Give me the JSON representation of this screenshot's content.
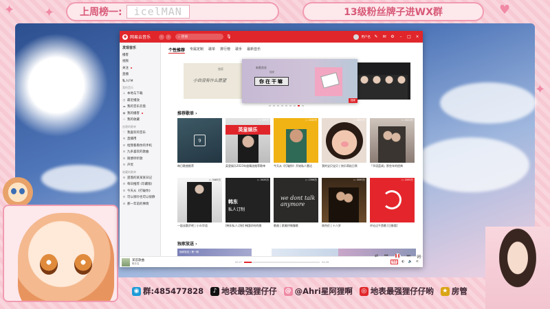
{
  "overlay": {
    "rank_label": "上周榜一:",
    "rank_name": "icelMAN",
    "group_text": "13级粉丝牌子进WX群",
    "socials": [
      {
        "icon": "penguin-icon",
        "text": "群:485477828",
        "color": "#1e9bd7"
      },
      {
        "icon": "douyin-icon",
        "text": "地表最强狸仔仔",
        "color": "#111111"
      },
      {
        "icon": "at-icon",
        "text": "@Ahri星阿狸啊",
        "color": "#f08aa5"
      },
      {
        "icon": "weibo-icon",
        "text": "地表最强狸仔仔哟",
        "color": "#e0262b"
      },
      {
        "icon": "badge-icon",
        "text": "房管",
        "color": "#d9a514"
      }
    ]
  },
  "app": {
    "name": "网易云音乐",
    "search_placeholder": "搜索",
    "username": "用户名",
    "sidebar": {
      "top_items": [
        {
          "label": "发现音乐",
          "active": true,
          "icon": ""
        },
        {
          "label": "播客",
          "icon": ""
        },
        {
          "label": "视频",
          "icon": ""
        },
        {
          "label": "关注",
          "icon": "",
          "dot": true
        },
        {
          "label": "直播",
          "icon": ""
        },
        {
          "label": "私人FM",
          "icon": ""
        }
      ],
      "my_music_head": "我的音乐",
      "my_music": [
        {
          "label": "本地与下载",
          "icon": "↓"
        },
        {
          "label": "最近播放",
          "icon": "◷"
        },
        {
          "label": "我的音乐云盘",
          "icon": "☁"
        },
        {
          "label": "我的播客",
          "icon": "◉",
          "dot": true
        },
        {
          "label": "我的收藏",
          "icon": "☆"
        }
      ],
      "created_head": "创建的歌单",
      "created": [
        {
          "label": "我喜欢的音乐",
          "icon": "♡"
        },
        {
          "label": "直播用",
          "icon": "≡"
        },
        {
          "label": "给我看看你的手机",
          "icon": "≡"
        },
        {
          "label": "九条喜欢的歌曲",
          "icon": "≡"
        },
        {
          "label": "随便听听歌",
          "icon": "≡"
        },
        {
          "label": "声优",
          "icon": "≡"
        }
      ],
      "collected_head": "收藏的歌单",
      "collected": [
        {
          "label": "遗落的某某某日记",
          "icon": "≡"
        },
        {
          "label": "每日推荐 (珍藏版)",
          "icon": "≡"
        },
        {
          "label": "今天从《打破你》",
          "icon": "≡"
        },
        {
          "label": "可以很吵也可以很静",
          "icon": "≡"
        },
        {
          "label": "那一年前的事情",
          "icon": "≡"
        }
      ]
    },
    "tabs": [
      "个性推荐",
      "专属定制",
      "歌单",
      "排行榜",
      "歌手",
      "最新音乐"
    ],
    "banner": {
      "left_text": "小白没有什么愿望",
      "left_sub": "独家",
      "center_sub": "新歌首发",
      "center_sub2": "独家",
      "center_title": "你在干嘛",
      "center_tag": "独家"
    },
    "section_playlists": "推荐歌单 ›",
    "section_exclusive": "独家放送 ›",
    "playlists": [
      {
        "title": "每日歌曲推荐",
        "plays": "",
        "cover": "c1",
        "cal": "9"
      },
      {
        "title": "英皇娱乐2023年度精选推荐歌单",
        "plays": "▷ 183万",
        "cover": "c2",
        "band": "英皇娱乐"
      },
      {
        "title": "今天从《打破你》开始私人雷达",
        "plays": "▷ 1042万",
        "cover": "c3"
      },
      {
        "title": "我的宝贝宝贝 | 快乐萌娃日常",
        "plays": "▷ 8855万",
        "cover": "c4"
      },
      {
        "title": "「华语蓝调」那些年的经典",
        "plays": "▷ 2021万",
        "cover": "c5"
      },
      {
        "title": "一起去散步吧 | 小众华语",
        "plays": "▷ 3465万",
        "cover": "c6"
      },
      {
        "title": "[韩东私人订制] 韩国好听的歌",
        "plays": "▷ 3435万",
        "cover": "c7",
        "t1": "韩东",
        "t2": "私人订制"
      },
      {
        "title": "歌曲 | 欧美抒情慢歌",
        "plays": "▷ 1356万",
        "cover": "c8",
        "hand": "we dont talk anymore"
      },
      {
        "title": "周杰伦 | 十八岁",
        "plays": "▷ 5093万",
        "cover": "c9"
      },
      {
        "title": "评论过千首歌 [日推版]",
        "plays": "▷ 2005万",
        "cover": "c10"
      }
    ],
    "exclusive": [
      {
        "text": "独家放送 | 第一期"
      }
    ],
    "player": {
      "song": "某首歌曲",
      "artist": "歌手名",
      "time_current": "00:27",
      "time_total": "04:26",
      "progress": 0.1,
      "quality": "极高"
    }
  }
}
